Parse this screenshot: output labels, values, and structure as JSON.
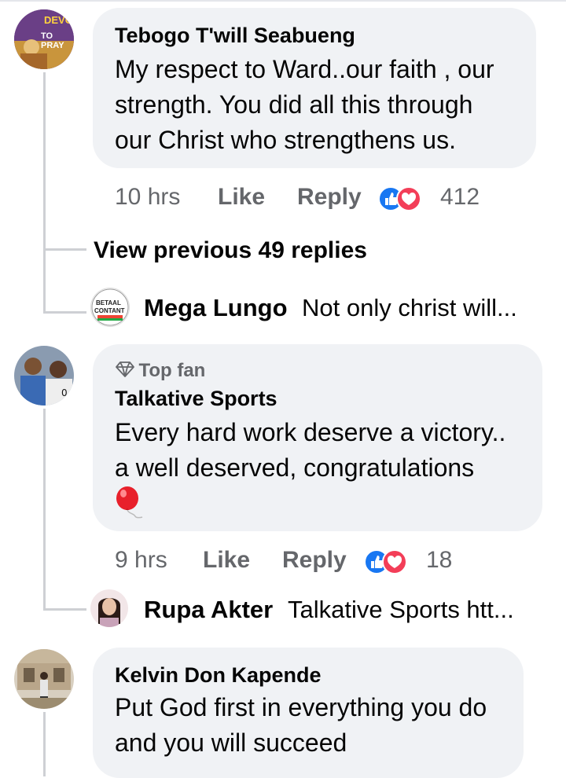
{
  "comments": [
    {
      "author": "Tebogo T'will Seabueng",
      "avatar_text": [
        "DEVO",
        "TO PRAY"
      ],
      "text_lines": [
        "My respect to Ward..our faith , our",
        "strength. You did all this through",
        "our Christ who strengthens us."
      ],
      "time": "10 hrs",
      "like_label": "Like",
      "reply_label": "Reply",
      "reaction_count": "412"
    },
    {
      "badge": "Top fan",
      "author": "Talkative Sports",
      "text_lines": [
        "Every hard work deserve a victory..",
        "a well deserved, congratulations"
      ],
      "emoji": "balloon",
      "time": "9 hrs",
      "like_label": "Like",
      "reply_label": "Reply",
      "reaction_count": "18"
    },
    {
      "author": "Kelvin Don Kapende",
      "text_lines": [
        "Put God first in everything you do",
        "and you will succeed"
      ]
    }
  ],
  "view_previous": "View previous 49 replies",
  "replies": [
    {
      "author": "Mega Lungo",
      "preview": "Not only christ will...",
      "avatar_text": [
        "BETAAL",
        "CONTANT"
      ]
    },
    {
      "author": "Rupa Akter",
      "preview": "Talkative Sports htt..."
    }
  ],
  "colors": {
    "bubble": "#f0f2f5",
    "meta": "#65676b",
    "like_blue": "#1877f2",
    "love_red": "#f33e58",
    "thread": "#ced0d4"
  }
}
